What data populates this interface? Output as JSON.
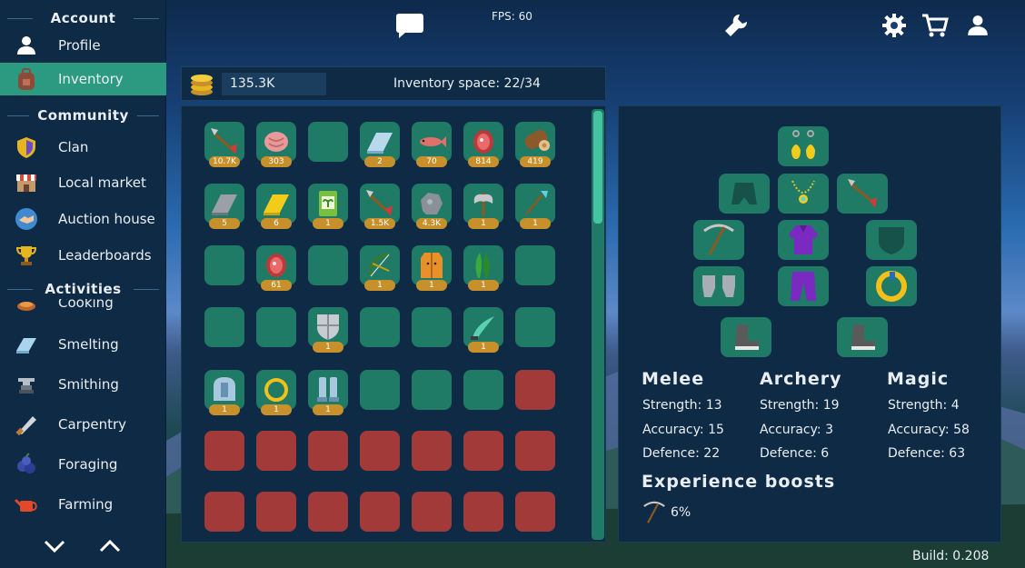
{
  "sidebar": {
    "sections": [
      {
        "title": "Account",
        "items": [
          {
            "label": "Profile",
            "icon": "person-icon"
          },
          {
            "label": "Inventory",
            "icon": "backpack-icon",
            "active": true
          }
        ]
      },
      {
        "title": "Community",
        "items": [
          {
            "label": "Clan",
            "icon": "shield-icon"
          },
          {
            "label": "Local market",
            "icon": "market-icon"
          },
          {
            "label": "Auction house",
            "icon": "handshake-icon"
          },
          {
            "label": "Leaderboards",
            "icon": "trophy-icon"
          }
        ]
      },
      {
        "title": "Activities",
        "items": [
          {
            "label": "Cooking",
            "icon": "cooking-icon"
          },
          {
            "label": "Smelting",
            "icon": "bar-icon"
          },
          {
            "label": "Smithing",
            "icon": "anvil-icon"
          },
          {
            "label": "Carpentry",
            "icon": "saw-icon"
          },
          {
            "label": "Foraging",
            "icon": "berries-icon"
          },
          {
            "label": "Farming",
            "icon": "watering-can-icon"
          }
        ]
      }
    ]
  },
  "topbar": {
    "fps": "FPS: 60"
  },
  "inventory": {
    "gold": "135.3K",
    "space": "Inventory space: 22/34",
    "rows": [
      [
        {
          "i": "arrow",
          "q": "10.7K"
        },
        {
          "i": "meat",
          "q": "303"
        },
        {
          "i": "",
          "q": ""
        },
        {
          "i": "silver-bar",
          "q": "2"
        },
        {
          "i": "fish",
          "q": "70"
        },
        {
          "i": "steak",
          "q": "814"
        },
        {
          "i": "log",
          "q": "419"
        }
      ],
      [
        {
          "i": "iron-bar",
          "q": "5"
        },
        {
          "i": "gold-bar",
          "q": "6"
        },
        {
          "i": "seed-pack",
          "q": "1"
        },
        {
          "i": "arrow",
          "q": "1.5K"
        },
        {
          "i": "ore",
          "q": "4.3K"
        },
        {
          "i": "axe",
          "q": "1"
        },
        {
          "i": "spear",
          "q": "1"
        }
      ],
      [
        {
          "i": "",
          "q": ""
        },
        {
          "i": "steak",
          "q": "61"
        },
        {
          "i": "",
          "q": ""
        },
        {
          "i": "bow",
          "q": "1"
        },
        {
          "i": "vest",
          "q": "1"
        },
        {
          "i": "plant",
          "q": "1"
        },
        {
          "i": "",
          "q": ""
        }
      ],
      [
        {
          "i": "",
          "q": ""
        },
        {
          "i": "",
          "q": ""
        },
        {
          "i": "shield",
          "q": "1"
        },
        {
          "i": "",
          "q": ""
        },
        {
          "i": "",
          "q": ""
        },
        {
          "i": "dagger",
          "q": "1"
        },
        {
          "i": "",
          "q": ""
        }
      ],
      [
        {
          "i": "helmet",
          "q": "1"
        },
        {
          "i": "ring",
          "q": "1"
        },
        {
          "i": "greaves",
          "q": "1"
        },
        {
          "i": "",
          "q": ""
        },
        {
          "i": "",
          "q": ""
        },
        {
          "i": "",
          "q": ""
        },
        {
          "i": "locked",
          "q": ""
        }
      ],
      [
        {
          "i": "locked",
          "q": ""
        },
        {
          "i": "locked",
          "q": ""
        },
        {
          "i": "locked",
          "q": ""
        },
        {
          "i": "locked",
          "q": ""
        },
        {
          "i": "locked",
          "q": ""
        },
        {
          "i": "locked",
          "q": ""
        },
        {
          "i": "locked",
          "q": ""
        }
      ],
      [
        {
          "i": "locked",
          "q": ""
        },
        {
          "i": "locked",
          "q": ""
        },
        {
          "i": "locked",
          "q": ""
        },
        {
          "i": "locked",
          "q": ""
        },
        {
          "i": "locked",
          "q": ""
        },
        {
          "i": "locked",
          "q": ""
        },
        {
          "i": "locked",
          "q": ""
        }
      ]
    ]
  },
  "stats": {
    "melee": {
      "title": "Melee",
      "strength": "Strength: 13",
      "accuracy": "Accuracy: 15",
      "defence": "Defence: 22"
    },
    "archery": {
      "title": "Archery",
      "strength": "Strength: 19",
      "accuracy": "Accuracy: 3",
      "defence": "Defence: 6"
    },
    "magic": {
      "title": "Magic",
      "strength": "Strength: 4",
      "accuracy": "Accuracy: 58",
      "defence": "Defence: 63"
    },
    "boosts_title": "Experience boosts",
    "boost_value": "6%"
  },
  "build": "Build: 0.208"
}
